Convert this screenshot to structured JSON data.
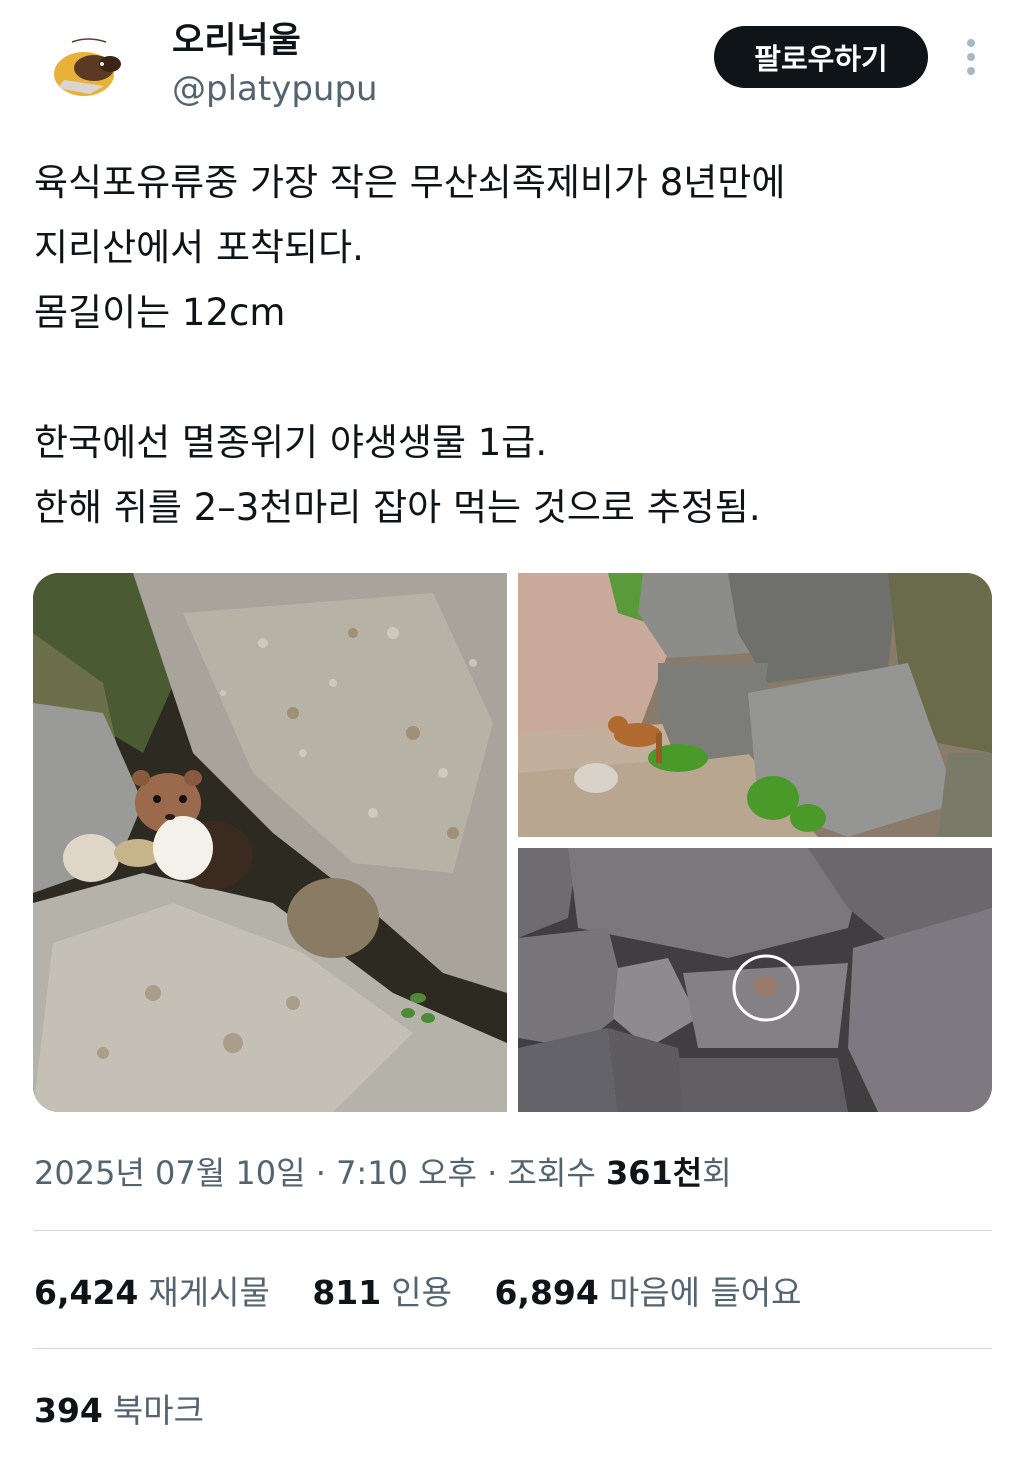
{
  "author": {
    "display_name": "오리넉울",
    "handle": "@platypupu",
    "avatar_icon": "platypus-avatar"
  },
  "header": {
    "follow_label": "팔로우하기",
    "more_icon": "more-vertical-icon"
  },
  "tweet": {
    "lines": [
      "육식포유류중 가장 작은 무산쇠족제비가 8년만에",
      "지리산에서 포착되다.",
      "몸길이는 12cm",
      "",
      "한국에선 멸종위기 야생생물 1급.",
      "한해 쥐를 2–3천마리 잡아 먹는 것으로 추정됨."
    ]
  },
  "media": [
    {
      "subject": "weasel peeking out from between granite rocks"
    },
    {
      "subject": "weasel standing on a path beside a stone wall"
    },
    {
      "subject": "weasel circled inside a stacked stone wall"
    }
  ],
  "meta": {
    "date": "2025년 07월 10일",
    "separator": "·",
    "time": "7:10 오후",
    "views_label": "조회수",
    "views_count": "361천",
    "views_suffix": "회"
  },
  "stats": {
    "retweets": {
      "count": "6,424",
      "label": "재게시물"
    },
    "quotes": {
      "count": "811",
      "label": "인용"
    },
    "likes": {
      "count": "6,894",
      "label": "마음에 들어요"
    },
    "bookmarks": {
      "count": "394",
      "label": "북마크"
    }
  },
  "colors": {
    "text_primary": "#0f1419",
    "text_secondary": "#536471",
    "divider": "#cfd9de",
    "follow_bg": "#0f1419"
  }
}
